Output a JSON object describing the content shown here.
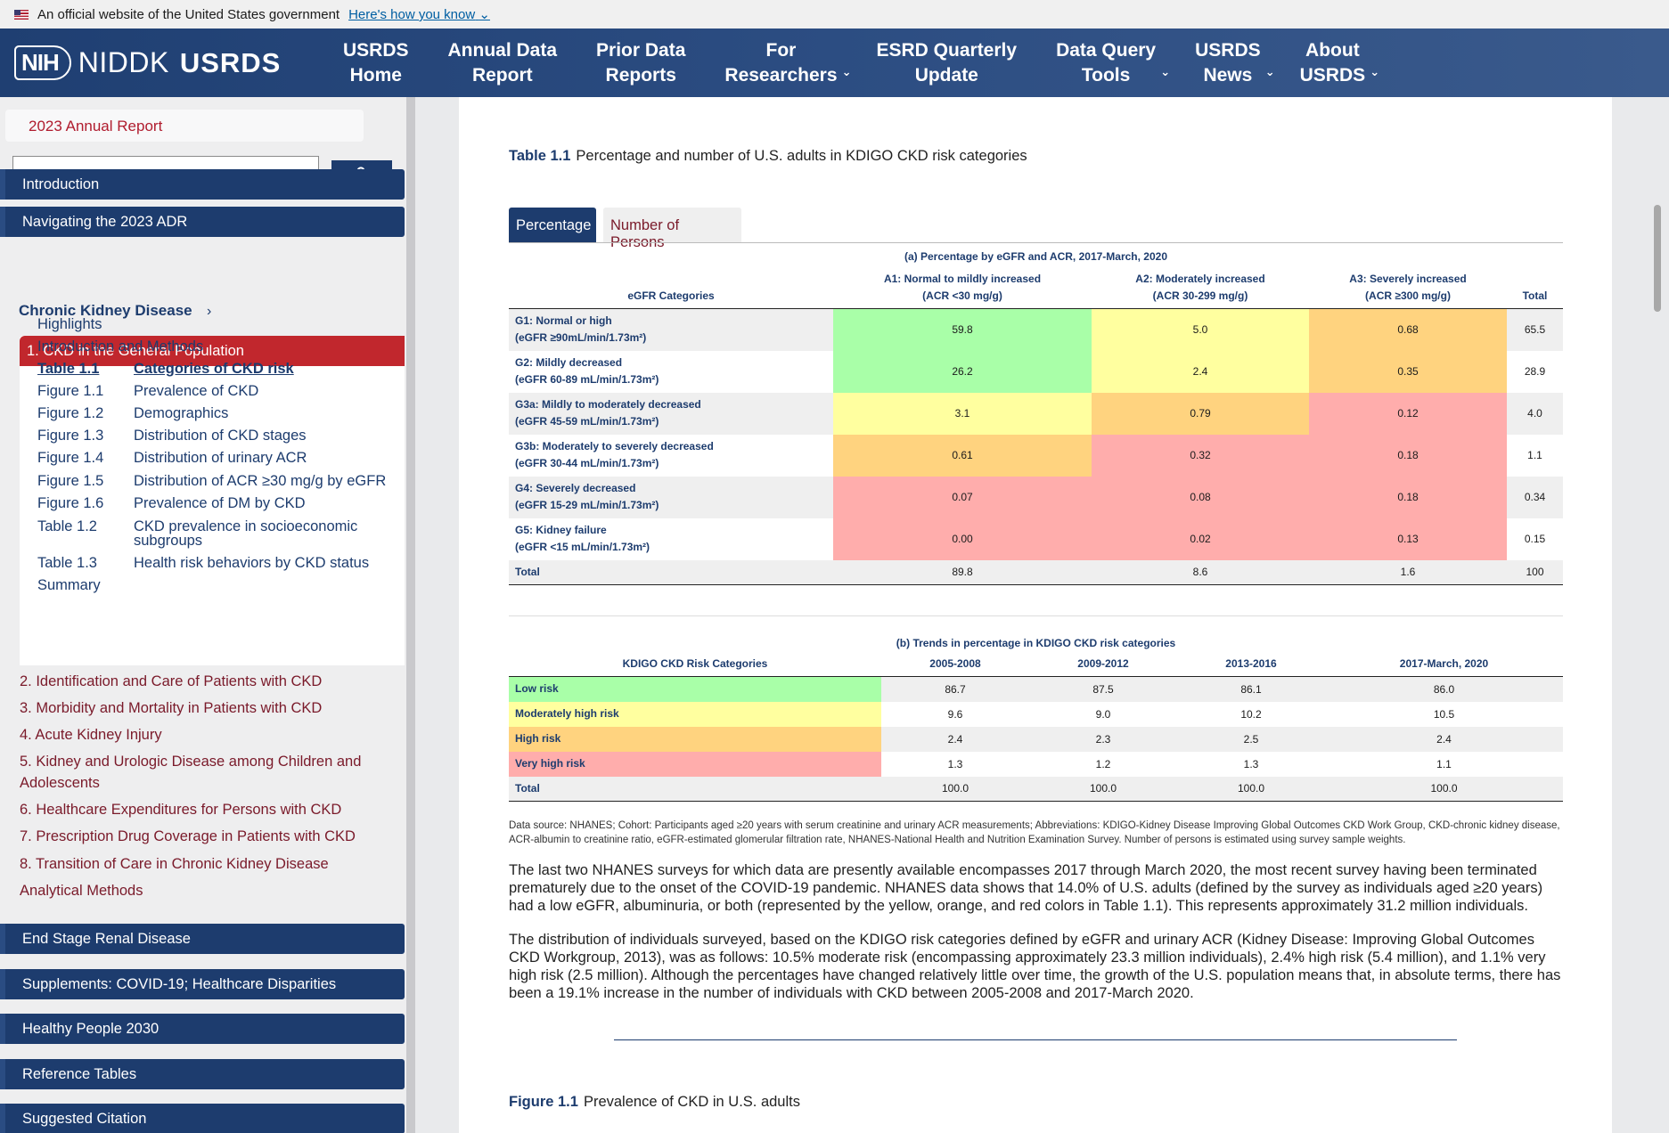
{
  "gov_banner": {
    "text": "An official website of the United States government",
    "link": "Here's how you know"
  },
  "header": {
    "nih": "NIH",
    "niddk": "NIDDK",
    "usrds": "USRDS",
    "nav": [
      {
        "label": "USRDS\nHome",
        "dropdown": false
      },
      {
        "label": "Annual Data\nReport",
        "dropdown": false
      },
      {
        "label": "Prior Data\nReports",
        "dropdown": false
      },
      {
        "label": "For\nResearchers",
        "dropdown": true
      },
      {
        "label": "ESRD Quarterly\nUpdate",
        "dropdown": false
      },
      {
        "label": "Data Query\nTools",
        "dropdown": true
      },
      {
        "label": "USRDS\nNews",
        "dropdown": true
      },
      {
        "label": "About\nUSRDS",
        "dropdown": true
      }
    ]
  },
  "sidebar": {
    "report_tab": "2023 Annual Report",
    "search_placeholder": "",
    "sections_top": [
      "Introduction",
      "Navigating the 2023 ADR"
    ],
    "ckd_heading": "Chronic Kidney Disease",
    "active_chapter": "1. CKD in the General Population",
    "sub_items": [
      {
        "num": "Highlights",
        "label": ""
      },
      {
        "num": "Introduction and Methods",
        "label": ""
      },
      {
        "num": "Table 1.1",
        "label": "Categories of CKD risk"
      },
      {
        "num": "Figure 1.1",
        "label": "Prevalence of CKD"
      },
      {
        "num": "Figure 1.2",
        "label": "Demographics"
      },
      {
        "num": "Figure 1.3",
        "label": "Distribution of CKD stages"
      },
      {
        "num": "Figure 1.4",
        "label": "Distribution of urinary ACR"
      },
      {
        "num": "Figure 1.5",
        "label": "Distribution of ACR ≥30 mg/g by eGFR"
      },
      {
        "num": "Figure 1.6",
        "label": "Prevalence of DM by CKD"
      },
      {
        "num": "Table 1.2",
        "label": "CKD prevalence in socioeconomic subgroups"
      },
      {
        "num": "Table 1.3",
        "label": "Health risk behaviors by CKD status"
      },
      {
        "num": "Summary",
        "label": ""
      }
    ],
    "chapters": [
      "2. Identification and Care of Patients with CKD",
      "3. Morbidity and Mortality in Patients with CKD",
      "4. Acute Kidney Injury",
      "5. Kidney and Urologic Disease among Children and Adolescents",
      "6. Healthcare Expenditures for Persons with CKD",
      "7. Prescription Drug Coverage in Patients with CKD",
      "8. Transition of Care in Chronic Kidney Disease",
      "Analytical Methods"
    ],
    "sections_bottom": [
      "End Stage Renal Disease",
      "Supplements: COVID-19; Healthcare Disparities",
      "Healthy People 2030",
      "Reference Tables",
      "Suggested Citation"
    ]
  },
  "main": {
    "table_label": "Table 1.1",
    "table_title": "Percentage and number of U.S. adults in KDIGO CKD risk categories",
    "tabs": [
      "Percentage",
      "Number of Persons"
    ],
    "table_a": {
      "caption": "(a) Percentage by eGFR and ACR, 2017-March, 2020",
      "col_headers": [
        "eGFR Categories",
        "A1: Normal to mildly increased\n(ACR <30 mg/g)",
        "A2: Moderately increased\n(ACR 30-299 mg/g)",
        "A3: Severely increased\n(ACR ≥300 mg/g)",
        "Total"
      ],
      "rows": [
        {
          "label": "G1: Normal or high\n(eGFR ≥90mL/min/1.73m²)",
          "values": [
            "59.8",
            "5.0",
            "0.68",
            "65.5"
          ],
          "colors": [
            "g",
            "y",
            "o"
          ]
        },
        {
          "label": "G2: Mildly decreased\n(eGFR 60-89 mL/min/1.73m²)",
          "values": [
            "26.2",
            "2.4",
            "0.35",
            "28.9"
          ],
          "colors": [
            "g",
            "y",
            "o"
          ]
        },
        {
          "label": "G3a: Mildly to moderately decreased\n(eGFR 45-59 mL/min/1.73m²)",
          "values": [
            "3.1",
            "0.79",
            "0.12",
            "4.0"
          ],
          "colors": [
            "y",
            "o",
            "r"
          ]
        },
        {
          "label": "G3b: Moderately to severely decreased\n(eGFR 30-44 mL/min/1.73m²)",
          "values": [
            "0.61",
            "0.32",
            "0.18",
            "1.1"
          ],
          "colors": [
            "o",
            "r",
            "r"
          ]
        },
        {
          "label": "G4: Severely decreased\n(eGFR 15-29 mL/min/1.73m²)",
          "values": [
            "0.07",
            "0.08",
            "0.18",
            "0.34"
          ],
          "colors": [
            "r",
            "r",
            "r"
          ]
        },
        {
          "label": "G5: Kidney failure\n(eGFR <15 mL/min/1.73m²)",
          "values": [
            "0.00",
            "0.02",
            "0.13",
            "0.15"
          ],
          "colors": [
            "r",
            "r",
            "r"
          ]
        }
      ],
      "total": {
        "label": "Total",
        "values": [
          "89.8",
          "8.6",
          "1.6",
          "100"
        ]
      }
    },
    "table_b": {
      "caption": "(b) Trends in percentage in KDIGO CKD risk categories",
      "col_headers": [
        "KDIGO CKD Risk Categories",
        "2005-2008",
        "2009-2012",
        "2013-2016",
        "2017-March, 2020"
      ],
      "rows": [
        {
          "label": "Low risk",
          "values": [
            "86.7",
            "87.5",
            "86.1",
            "86.0"
          ],
          "color": "g"
        },
        {
          "label": "Moderately high risk",
          "values": [
            "9.6",
            "9.0",
            "10.2",
            "10.5"
          ],
          "color": "y"
        },
        {
          "label": "High risk",
          "values": [
            "2.4",
            "2.3",
            "2.5",
            "2.4"
          ],
          "color": "o"
        },
        {
          "label": "Very high risk",
          "values": [
            "1.3",
            "1.2",
            "1.3",
            "1.1"
          ],
          "color": "r"
        }
      ],
      "total": {
        "label": "Total",
        "values": [
          "100.0",
          "100.0",
          "100.0",
          "100.0"
        ]
      }
    },
    "colors": {
      "low": "#a9ffa8",
      "moderate": "#ffff9f",
      "high": "#ffd37f",
      "very_high": "#ffadac",
      "navy": "#1d3c6e",
      "active_red": "#c1272d"
    },
    "data_note": "Data source: NHANES; Cohort: Participants aged ≥20 years with serum creatinine and urinary ACR measurements; Abbreviations: KDIGO-Kidney Disease Improving Global Outcomes CKD Work Group, CKD-chronic kidney disease, ACR-albumin to creatinine ratio, eGFR-estimated glomerular filtration rate, NHANES-National Health and Nutrition Examination Survey. Number of persons is estimated using survey sample weights.",
    "para1": "The last two NHANES surveys for which data are presently available encompasses 2017 through March 2020, the most recent survey having been terminated prematurely due to the onset of the COVID-19 pandemic. NHANES data shows that 14.0% of U.S. adults (defined by the survey as individuals aged ≥20 years) had a low eGFR, albuminuria, or both (represented by the yellow, orange, and red colors in Table 1.1). This represents approximately 31.2 million individuals.",
    "para2": "The distribution of individuals surveyed, based on the KDIGO risk categories defined by eGFR and urinary ACR (Kidney Disease: Improving Global Outcomes CKD Workgroup, 2013), was as follows: 10.5% moderate risk (encompassing approximately 23.3 million individuals), 2.4% high risk (5.4 million), and 1.1% very high risk (2.5 million). Although the percentages have changed relatively little over time, the growth of the U.S. population means that, in absolute terms, there has been a 19.1% increase in the number of individuals with CKD between 2005-2008 and 2017-March 2020.",
    "figure_label": "Figure 1.1",
    "figure_title": "Prevalence of CKD in U.S. adults"
  }
}
